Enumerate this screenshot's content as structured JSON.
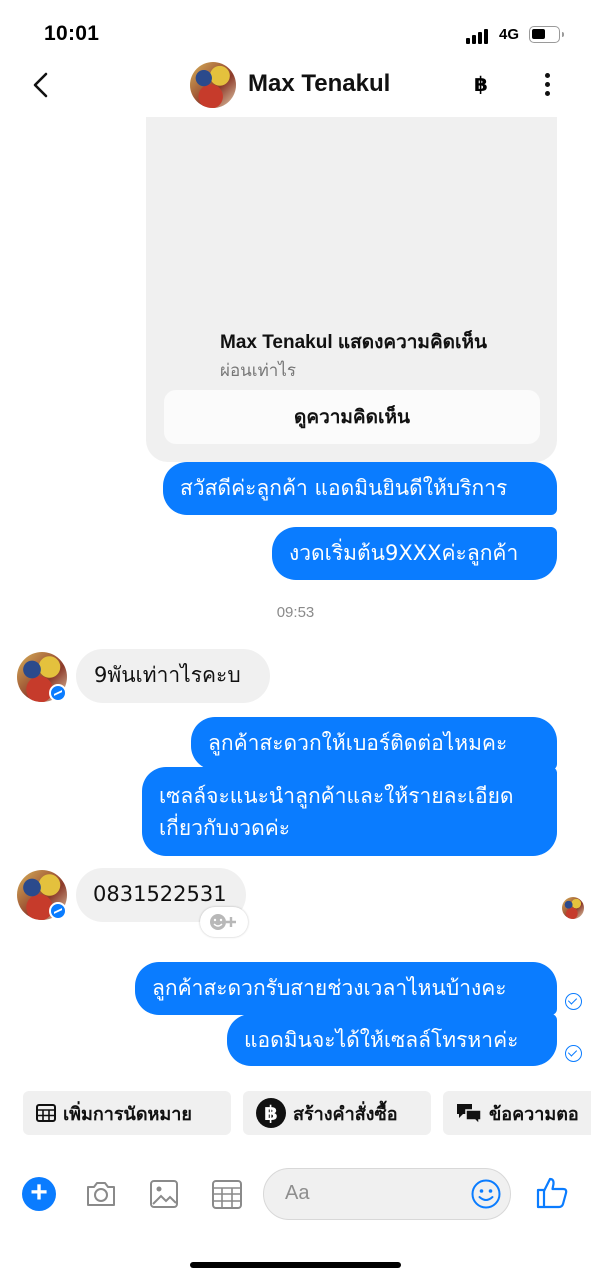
{
  "status_bar": {
    "time": "10:01",
    "network": "4G"
  },
  "header": {
    "contact_name": "Max Tenakul",
    "currency_symbol": "฿"
  },
  "shared_post": {
    "author": "Max Tenakul",
    "action": "แสดงความคิดเห็น",
    "comment": "ผ่อนเท่าไร",
    "view_button": "ดูความคิดเห็น"
  },
  "messages": [
    {
      "id": "m1",
      "direction": "outgoing",
      "text": "สวัสดีค่ะลูกค้า แอดมินยินดีให้บริการ"
    },
    {
      "id": "m2",
      "direction": "outgoing",
      "text": "งวดเริ่มต้น9XXXค่ะลูกค้า"
    },
    {
      "id": "m3",
      "direction": "incoming",
      "text": "9พันเท่าาไรคะบ"
    },
    {
      "id": "m4",
      "direction": "outgoing",
      "text": "ลูกค้าสะดวกให้เบอร์ติดต่อไหมคะ"
    },
    {
      "id": "m5",
      "direction": "outgoing",
      "text": "เซลล์จะแนะนำลูกค้าและให้รายละเอียด\nเกี่ยวกับงวดค่ะ"
    },
    {
      "id": "m6",
      "direction": "incoming",
      "text": "0831522531"
    },
    {
      "id": "m7",
      "direction": "outgoing",
      "text": "ลูกค้าสะดวกรับสายช่วงเวลาไหนบ้างคะ"
    },
    {
      "id": "m8",
      "direction": "outgoing",
      "text": "แอดมินจะได้ให้เซลล์โทรหาค่ะ"
    }
  ],
  "timestamp": "09:53",
  "quick_actions": [
    {
      "label": "เพิ่มการนัดหมาย",
      "icon": "calendar-icon"
    },
    {
      "label": "สร้างคำสั่งซื้อ",
      "icon": "baht-icon"
    },
    {
      "label": "ข้อความตอ",
      "icon": "chat-bubbles-icon"
    }
  ],
  "composer": {
    "placeholder": "Aa"
  },
  "colors": {
    "messenger_blue": "#0a7cff",
    "incoming_bubble": "#f0f0f0"
  }
}
